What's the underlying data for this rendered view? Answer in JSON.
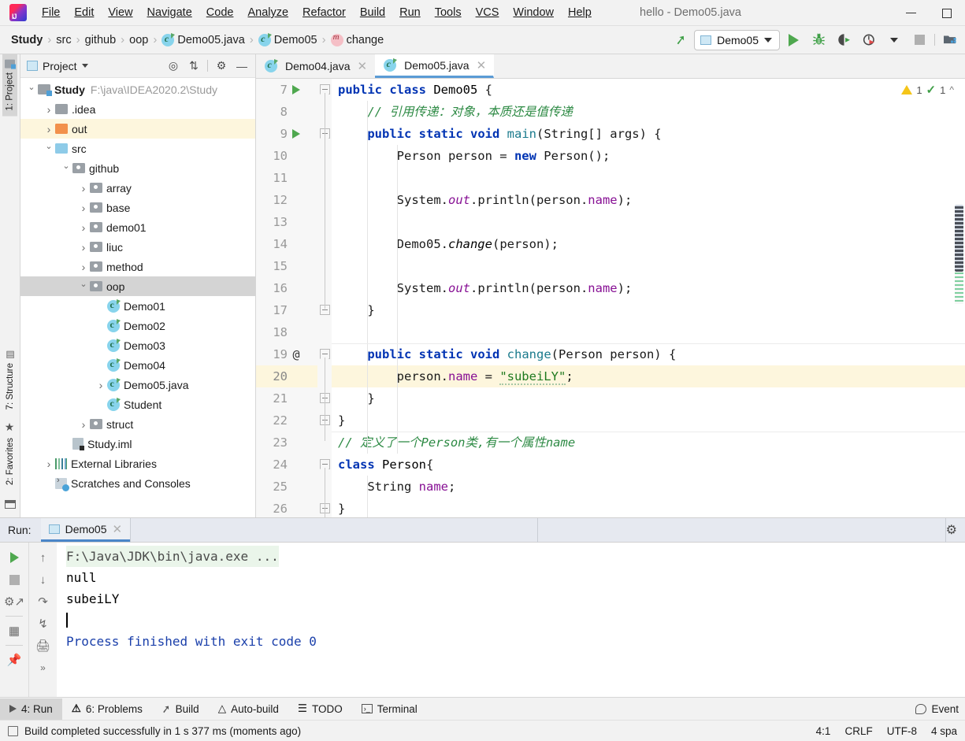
{
  "window": {
    "title": "hello - Demo05.java",
    "minimize_label": "minimize",
    "maximize_label": "maximize"
  },
  "menubar": {
    "items": [
      "File",
      "Edit",
      "View",
      "Navigate",
      "Code",
      "Analyze",
      "Refactor",
      "Build",
      "Run",
      "Tools",
      "VCS",
      "Window",
      "Help"
    ]
  },
  "breadcrumb": {
    "items": [
      {
        "label": "Study",
        "icon": "none",
        "bold": true
      },
      {
        "label": "src",
        "icon": "none",
        "bold": false
      },
      {
        "label": "github",
        "icon": "none",
        "bold": false
      },
      {
        "label": "oop",
        "icon": "none",
        "bold": false
      },
      {
        "label": "Demo05.java",
        "icon": "java-class-icon",
        "bold": false
      },
      {
        "label": "Demo05",
        "icon": "java-class-icon",
        "bold": false
      },
      {
        "label": "change",
        "icon": "method-icon",
        "bold": false
      }
    ],
    "separator": "›"
  },
  "toolbar": {
    "build_label": "Build",
    "run_config_name": "Demo05",
    "run_label": "Run",
    "debug_label": "Debug",
    "run_coverage_label": "Run with Coverage",
    "profiler_label": "Profiler",
    "stop_label": "Stop",
    "project_structure_label": "Project Structure"
  },
  "left_strip": {
    "tabs": [
      {
        "label": "1: Project",
        "active": true
      },
      {
        "label": "7: Structure",
        "active": false
      },
      {
        "label": "2: Favorites",
        "active": false
      }
    ]
  },
  "project_panel": {
    "title": "Project",
    "actions": [
      "locate-icon",
      "collapse-all-icon",
      "settings-icon",
      "hide-icon"
    ],
    "tree": [
      {
        "label": "Study",
        "detail": "F:\\java\\IDEA2020.2\\Study",
        "depth": 0,
        "arrow": "open",
        "icon": "module-folder",
        "bold": true,
        "state": "none"
      },
      {
        "label": ".idea",
        "detail": "",
        "depth": 1,
        "arrow": "closed",
        "icon": "folder-gray",
        "bold": false,
        "state": "none"
      },
      {
        "label": "out",
        "detail": "",
        "depth": 1,
        "arrow": "closed",
        "icon": "folder-orange",
        "bold": false,
        "state": "highlighted"
      },
      {
        "label": "src",
        "detail": "",
        "depth": 1,
        "arrow": "open",
        "icon": "folder-blue",
        "bold": false,
        "state": "none"
      },
      {
        "label": "github",
        "detail": "",
        "depth": 2,
        "arrow": "open",
        "icon": "folder-package",
        "bold": false,
        "state": "none"
      },
      {
        "label": "array",
        "detail": "",
        "depth": 3,
        "arrow": "closed",
        "icon": "folder-package",
        "bold": false,
        "state": "none"
      },
      {
        "label": "base",
        "detail": "",
        "depth": 3,
        "arrow": "closed",
        "icon": "folder-package",
        "bold": false,
        "state": "none"
      },
      {
        "label": "demo01",
        "detail": "",
        "depth": 3,
        "arrow": "closed",
        "icon": "folder-package",
        "bold": false,
        "state": "none"
      },
      {
        "label": "liuc",
        "detail": "",
        "depth": 3,
        "arrow": "closed",
        "icon": "folder-package",
        "bold": false,
        "state": "none"
      },
      {
        "label": "method",
        "detail": "",
        "depth": 3,
        "arrow": "closed",
        "icon": "folder-package",
        "bold": false,
        "state": "none"
      },
      {
        "label": "oop",
        "detail": "",
        "depth": 3,
        "arrow": "open",
        "icon": "folder-package",
        "bold": false,
        "state": "selected"
      },
      {
        "label": "Demo01",
        "detail": "",
        "depth": 4,
        "arrow": "none",
        "icon": "java-class",
        "bold": false,
        "state": "none"
      },
      {
        "label": "Demo02",
        "detail": "",
        "depth": 4,
        "arrow": "none",
        "icon": "java-class",
        "bold": false,
        "state": "none"
      },
      {
        "label": "Demo03",
        "detail": "",
        "depth": 4,
        "arrow": "none",
        "icon": "java-class",
        "bold": false,
        "state": "none"
      },
      {
        "label": "Demo04",
        "detail": "",
        "depth": 4,
        "arrow": "none",
        "icon": "java-class",
        "bold": false,
        "state": "none"
      },
      {
        "label": "Demo05.java",
        "detail": "",
        "depth": 4,
        "arrow": "closed",
        "icon": "java-class",
        "bold": false,
        "state": "none"
      },
      {
        "label": "Student",
        "detail": "",
        "depth": 4,
        "arrow": "none",
        "icon": "java-class",
        "bold": false,
        "state": "none"
      },
      {
        "label": "struct",
        "detail": "",
        "depth": 3,
        "arrow": "closed",
        "icon": "folder-package",
        "bold": false,
        "state": "none"
      },
      {
        "label": "Study.iml",
        "detail": "",
        "depth": 2,
        "arrow": "none",
        "icon": "iml-file",
        "bold": false,
        "state": "none"
      },
      {
        "label": "External Libraries",
        "detail": "",
        "depth": 1,
        "arrow": "closed",
        "icon": "libraries",
        "bold": false,
        "state": "none"
      },
      {
        "label": "Scratches and Consoles",
        "detail": "",
        "depth": 1,
        "arrow": "none",
        "icon": "scratches",
        "bold": false,
        "state": "none"
      }
    ]
  },
  "editor": {
    "tabs": [
      {
        "label": "Demo04.java",
        "active": false
      },
      {
        "label": "Demo05.java",
        "active": true
      }
    ],
    "inspection": {
      "warning_count": "1",
      "check_count": "1"
    },
    "first_line_number": 7,
    "lines": [
      {
        "num": "7",
        "gutter": "run",
        "fold": "start",
        "highlight": false,
        "tokens": [
          {
            "t": "public ",
            "c": "kw"
          },
          {
            "t": "class ",
            "c": "kw"
          },
          {
            "t": "Demo05",
            "c": "cls"
          },
          {
            "t": " {",
            "c": "plain"
          }
        ]
      },
      {
        "num": "8",
        "gutter": "none",
        "fold": "none",
        "highlight": false,
        "tokens": [
          {
            "t": "    // 引用传递：对象，本质还是值传递",
            "c": "cmt"
          }
        ]
      },
      {
        "num": "9",
        "gutter": "run",
        "fold": "start",
        "highlight": false,
        "tokens": [
          {
            "t": "    ",
            "c": "plain"
          },
          {
            "t": "public ",
            "c": "kw"
          },
          {
            "t": "static ",
            "c": "kw"
          },
          {
            "t": "void ",
            "c": "kw"
          },
          {
            "t": "main",
            "c": "mth"
          },
          {
            "t": "(String[] args) {",
            "c": "plain"
          }
        ]
      },
      {
        "num": "10",
        "gutter": "none",
        "fold": "none",
        "highlight": false,
        "tokens": [
          {
            "t": "        Person person = ",
            "c": "plain"
          },
          {
            "t": "new ",
            "c": "kw"
          },
          {
            "t": "Person();",
            "c": "plain"
          }
        ]
      },
      {
        "num": "11",
        "gutter": "none",
        "fold": "none",
        "highlight": false,
        "tokens": []
      },
      {
        "num": "12",
        "gutter": "none",
        "fold": "none",
        "highlight": false,
        "tokens": [
          {
            "t": "        System.",
            "c": "plain"
          },
          {
            "t": "out",
            "c": "ital"
          },
          {
            "t": ".println(person.",
            "c": "plain"
          },
          {
            "t": "name",
            "c": "fld"
          },
          {
            "t": ");",
            "c": "plain"
          }
        ]
      },
      {
        "num": "13",
        "gutter": "none",
        "fold": "none",
        "highlight": false,
        "tokens": []
      },
      {
        "num": "14",
        "gutter": "none",
        "fold": "none",
        "highlight": false,
        "tokens": [
          {
            "t": "        Demo05.",
            "c": "plain"
          },
          {
            "t": "change",
            "c": "mital"
          },
          {
            "t": "(person);",
            "c": "plain"
          }
        ]
      },
      {
        "num": "15",
        "gutter": "none",
        "fold": "none",
        "highlight": false,
        "tokens": []
      },
      {
        "num": "16",
        "gutter": "none",
        "fold": "none",
        "highlight": false,
        "tokens": [
          {
            "t": "        System.",
            "c": "plain"
          },
          {
            "t": "out",
            "c": "ital"
          },
          {
            "t": ".println(person.",
            "c": "plain"
          },
          {
            "t": "name",
            "c": "fld"
          },
          {
            "t": ");",
            "c": "plain"
          }
        ]
      },
      {
        "num": "17",
        "gutter": "none",
        "fold": "end",
        "highlight": false,
        "tokens": [
          {
            "t": "    }",
            "c": "plain"
          }
        ]
      },
      {
        "num": "18",
        "gutter": "none",
        "fold": "none",
        "highlight": false,
        "tokens": []
      },
      {
        "num": "19",
        "gutter": "at",
        "fold": "start",
        "highlight": false,
        "tokens": [
          {
            "t": "    ",
            "c": "plain"
          },
          {
            "t": "public ",
            "c": "kw"
          },
          {
            "t": "static ",
            "c": "kw"
          },
          {
            "t": "void ",
            "c": "kw"
          },
          {
            "t": "change",
            "c": "mth"
          },
          {
            "t": "(Person person) {",
            "c": "plain"
          }
        ]
      },
      {
        "num": "20",
        "gutter": "none",
        "fold": "none",
        "highlight": true,
        "tokens": [
          {
            "t": "        person.",
            "c": "plain"
          },
          {
            "t": "name",
            "c": "fld"
          },
          {
            "t": " = ",
            "c": "plain"
          },
          {
            "t": "\"subeiLY\"",
            "c": "str"
          },
          {
            "t": ";",
            "c": "plain"
          }
        ]
      },
      {
        "num": "21",
        "gutter": "none",
        "fold": "end",
        "highlight": false,
        "tokens": [
          {
            "t": "    }",
            "c": "plain"
          }
        ]
      },
      {
        "num": "22",
        "gutter": "none",
        "fold": "end",
        "highlight": false,
        "tokens": [
          {
            "t": "}",
            "c": "plain"
          }
        ]
      },
      {
        "num": "23",
        "gutter": "none",
        "fold": "none",
        "highlight": false,
        "tokens": [
          {
            "t": "// 定义了一个Person类,有一个属性name",
            "c": "cmt"
          }
        ]
      },
      {
        "num": "24",
        "gutter": "none",
        "fold": "start",
        "highlight": false,
        "tokens": [
          {
            "t": "class ",
            "c": "kw"
          },
          {
            "t": "Person",
            "c": "cls"
          },
          {
            "t": "{",
            "c": "plain"
          }
        ]
      },
      {
        "num": "25",
        "gutter": "none",
        "fold": "none",
        "highlight": false,
        "tokens": [
          {
            "t": "    String ",
            "c": "plain"
          },
          {
            "t": "name",
            "c": "fld"
          },
          {
            "t": ";",
            "c": "plain"
          }
        ]
      },
      {
        "num": "26",
        "gutter": "none",
        "fold": "end",
        "highlight": false,
        "tokens": [
          {
            "t": "}",
            "c": "plain"
          }
        ]
      }
    ]
  },
  "run_panel": {
    "label": "Run:",
    "tab_label": "Demo05",
    "settings_label": "settings-icon",
    "tools_left": [
      "rerun-icon",
      "stop-icon",
      "dump-threads-icon",
      "layout-icon",
      "pin-icon"
    ],
    "tools_right": [
      "up-icon",
      "down-icon",
      "soft-wrap-icon",
      "scroll-end-icon",
      "print-icon",
      "expand-icon"
    ],
    "console": [
      {
        "text": "F:\\Java\\JDK\\bin\\java.exe ...",
        "style": "cmd"
      },
      {
        "text": "null",
        "style": "out"
      },
      {
        "text": "subeiLY",
        "style": "out"
      },
      {
        "text": "",
        "style": "caret"
      },
      {
        "text": "Process finished with exit code 0",
        "style": "finished"
      }
    ]
  },
  "bottom_bar": {
    "items": [
      {
        "label": "4: Run",
        "icon": "run-icon",
        "active": true
      },
      {
        "label": "6: Problems",
        "icon": "problems-icon",
        "active": false
      },
      {
        "label": "Build",
        "icon": "build-icon",
        "active": false
      },
      {
        "label": "Auto-build",
        "icon": "autobuild-icon",
        "active": false
      },
      {
        "label": "TODO",
        "icon": "todo-icon",
        "active": false
      },
      {
        "label": "Terminal",
        "icon": "terminal-icon",
        "active": false
      }
    ],
    "right_label": "Event"
  },
  "status_bar": {
    "message": "Build completed successfully in 1 s 377 ms (moments ago)",
    "caret_position": "4:1",
    "line_separator": "CRLF",
    "encoding": "UTF-8",
    "indent": "4 spa"
  },
  "colors": {
    "accent_blue": "#4a86c8",
    "keyword": "#0033b3",
    "comment": "#2d8a44",
    "string": "#1f7a1f",
    "field": "#871094",
    "method": "#1a7a8c",
    "highlight_line": "#fdf6dd",
    "selection": "#d4d4d4",
    "run_green": "#4fa84f"
  }
}
